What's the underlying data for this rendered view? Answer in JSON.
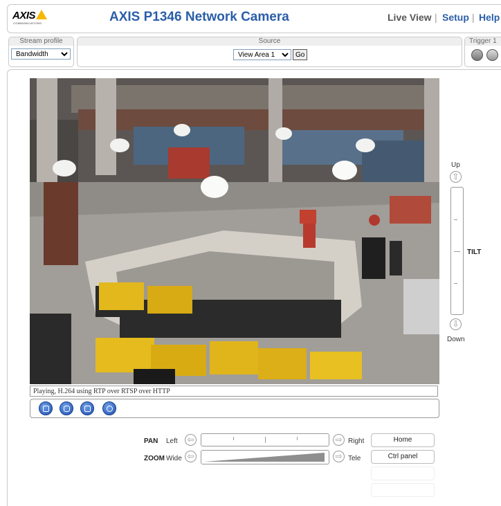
{
  "header": {
    "logo_text": "AXIS",
    "logo_sub": "COMMUNICATIONS",
    "title": "AXIS P1346 Network Camera",
    "nav": {
      "live_view": "Live View",
      "sep": "|",
      "setup": "Setup",
      "help": "Help"
    }
  },
  "toolbar": {
    "stream_profile": {
      "label": "Stream profile",
      "value": "Bandwidth"
    },
    "source": {
      "label": "Source",
      "value": "View Area 1",
      "go": "Go"
    },
    "trigger": {
      "label": "Trigger 1"
    }
  },
  "video": {
    "status": "Playing, H.264 using RTP over RTSP over HTTP"
  },
  "ptz": {
    "tilt": {
      "label": "TILT",
      "up": "Up",
      "down": "Down"
    },
    "pan": {
      "label": "PAN",
      "left": "Left",
      "right": "Right"
    },
    "zoom": {
      "label": "ZOOM",
      "wide": "Wide",
      "tele": "Tele"
    },
    "buttons": {
      "home": "Home",
      "ctrl_panel": "Ctrl panel"
    }
  },
  "colors": {
    "title_blue": "#2a5ea8",
    "button_blue": "#1f4fb0",
    "logo_yellow": "#f5b800"
  }
}
